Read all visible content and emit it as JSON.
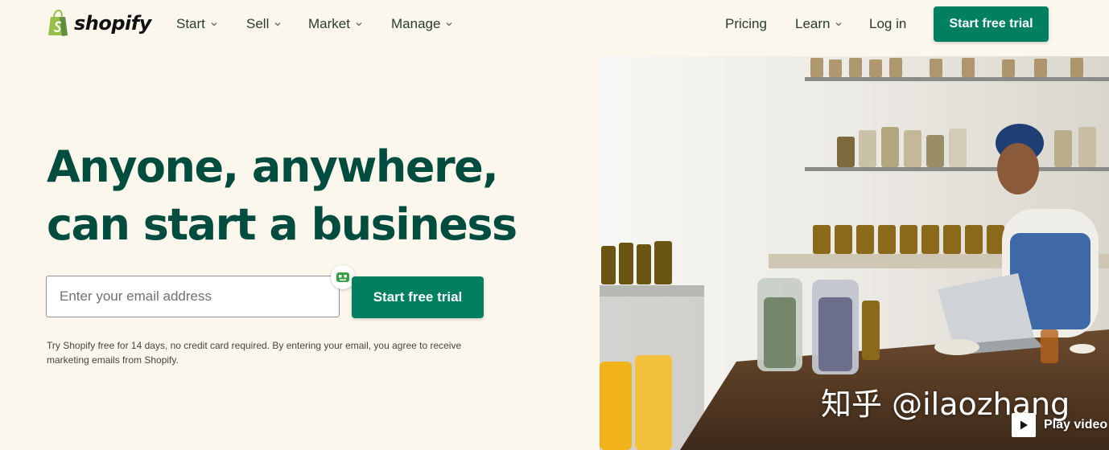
{
  "header": {
    "logo_text": "shopify",
    "nav_left": [
      {
        "label": "Start"
      },
      {
        "label": "Sell"
      },
      {
        "label": "Market"
      },
      {
        "label": "Manage"
      }
    ],
    "nav_right": {
      "pricing": "Pricing",
      "learn": "Learn",
      "login": "Log in",
      "cta": "Start free trial"
    }
  },
  "hero": {
    "title_line1": "Anyone, anywhere,",
    "title_line2": "can start a business",
    "email_placeholder": "Enter your email address",
    "cta": "Start free trial",
    "disclaimer_line1": "Try Shopify free for 14 days, no credit card required. By entering your email, you agree to receive",
    "disclaimer_line2": "marketing emails from Shopify."
  },
  "media": {
    "play_label": "Play video",
    "watermark": "知乎 @ilaozhang"
  },
  "colors": {
    "brand_green": "#008060",
    "heading_green": "#004c3f",
    "background": "#fbf7ed"
  }
}
